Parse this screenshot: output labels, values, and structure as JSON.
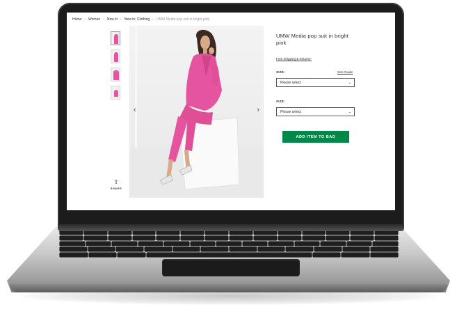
{
  "breadcrumb": [
    {
      "label": "Home"
    },
    {
      "label": "Women"
    },
    {
      "label": "New in"
    },
    {
      "label": "New in: Clothing"
    },
    {
      "label": "UMW Media pop suit in bright pink"
    }
  ],
  "breadcrumb_separator": "›",
  "product": {
    "title": "UMW Media pop suit in bright pink",
    "shipping_link": "Free Shipping & Returns*",
    "size_label_1": "SIZE:",
    "size_guide": "Size Guide",
    "select_1_value": "Please select",
    "size_label_2": "SIZE:",
    "select_2_value": "Please select",
    "add_button": "ADD ITEM TO BAG"
  },
  "gallery": {
    "thumbnail_count": 4,
    "prev_arrow": "‹",
    "next_arrow": "›",
    "share_label": "SHARE",
    "share_icon": "share-icon"
  },
  "colors": {
    "accent_green": "#018849",
    "product_pink": "#e5559f"
  }
}
